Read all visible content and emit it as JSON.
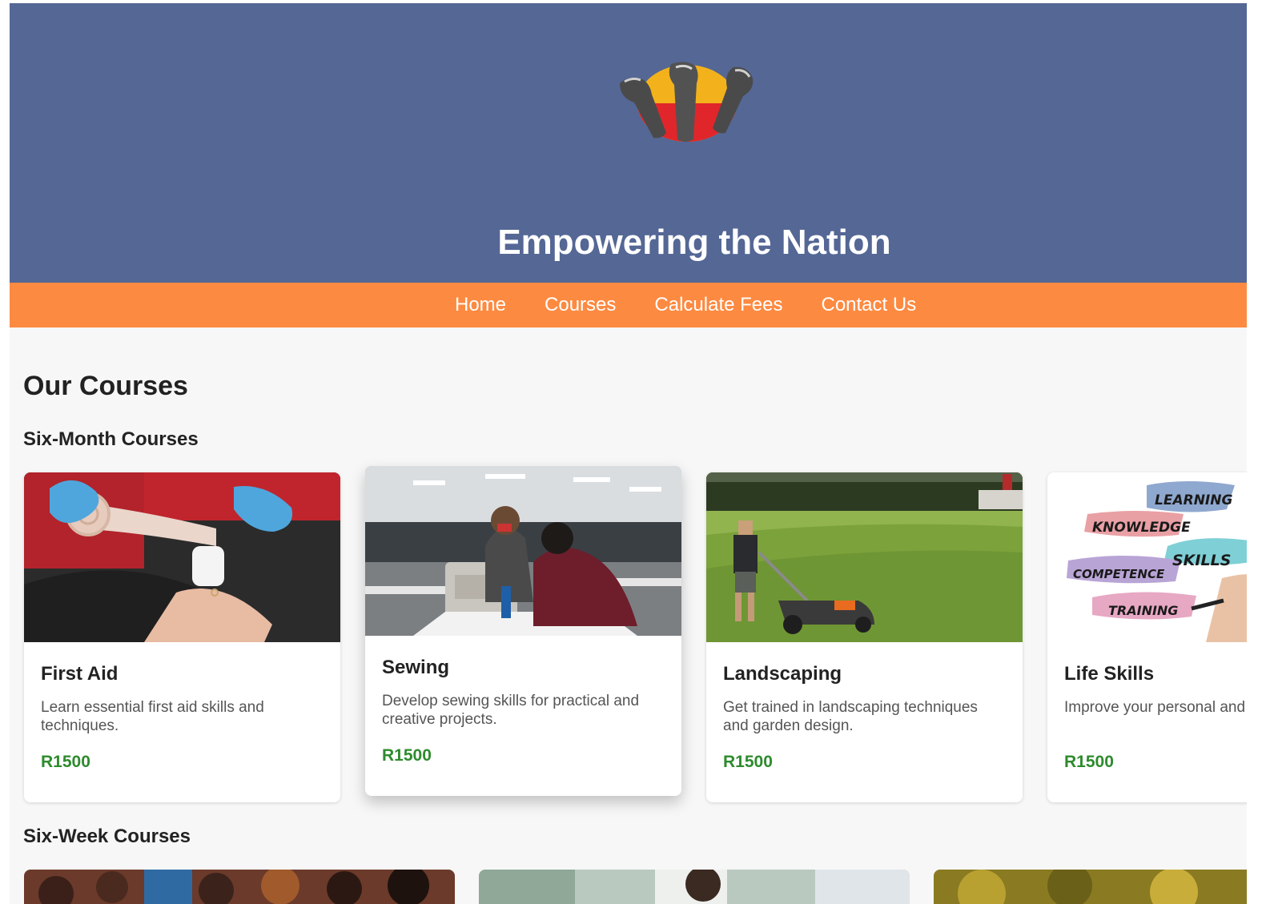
{
  "header": {
    "title": "Empowering the Nation",
    "logo_icon": "raised-fists-logo-icon",
    "background": "#546795"
  },
  "nav": {
    "background": "#fd8a41",
    "items": [
      {
        "label": "Home"
      },
      {
        "label": "Courses"
      },
      {
        "label": "Calculate Fees"
      },
      {
        "label": "Contact Us"
      }
    ]
  },
  "main": {
    "title": "Our Courses",
    "six_month": {
      "title": "Six-Month Courses",
      "courses": [
        {
          "title": "First Aid",
          "description": "Learn essential first aid skills and techniques.",
          "price": "R1500"
        },
        {
          "title": "Sewing",
          "description": "Develop sewing skills for practical and creative projects.",
          "price": "R1500"
        },
        {
          "title": "Landscaping",
          "description": "Get trained in landscaping techniques and garden design.",
          "price": "R1500"
        },
        {
          "title": "Life Skills",
          "description": "Improve your personal and life skills.",
          "price": "R1500",
          "image_words": [
            "LEARNING",
            "KNOWLEDGE",
            "SKILLS",
            "COMPETENCE",
            "TRAINING"
          ]
        }
      ]
    },
    "six_week": {
      "title": "Six-Week Courses"
    }
  },
  "colors": {
    "price": "#2e8b2e",
    "page_background": "#f7f7f7"
  }
}
